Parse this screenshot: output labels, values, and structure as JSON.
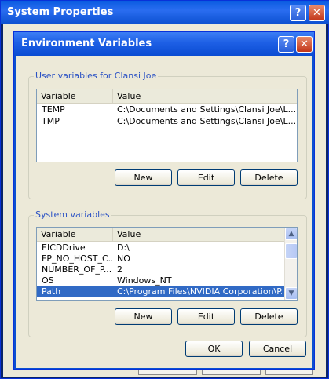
{
  "background_window": {
    "title": "System Properties",
    "help_glyph": "?",
    "close_glyph": "✕"
  },
  "dialog": {
    "title": "Environment Variables",
    "help_glyph": "?",
    "close_glyph": "✕",
    "user_group": {
      "label": "User variables for Clansi Joe",
      "columns": [
        "Variable",
        "Value"
      ],
      "rows": [
        {
          "variable": "TEMP",
          "value": "C:\\Documents and Settings\\Clansi Joe\\L..."
        },
        {
          "variable": "TMP",
          "value": "C:\\Documents and Settings\\Clansi Joe\\L..."
        }
      ],
      "buttons": {
        "new": "New",
        "edit": "Edit",
        "delete": "Delete"
      }
    },
    "system_group": {
      "label": "System variables",
      "columns": [
        "Variable",
        "Value"
      ],
      "rows": [
        {
          "variable": "EICDDrive",
          "value": "D:\\"
        },
        {
          "variable": "FP_NO_HOST_C...",
          "value": "NO"
        },
        {
          "variable": "NUMBER_OF_P...",
          "value": "2"
        },
        {
          "variable": "OS",
          "value": "Windows_NT"
        },
        {
          "variable": "Path",
          "value": "C:\\Program Files\\NVIDIA Corporation\\P..."
        }
      ],
      "selected_row": "Path",
      "buttons": {
        "new": "New",
        "edit": "Edit",
        "delete": "Delete"
      },
      "scroll_up_glyph": "▲",
      "scroll_down_glyph": "▼"
    },
    "ok_label": "OK",
    "cancel_label": "Cancel"
  },
  "colors": {
    "title_bar": "#0b4fd0",
    "selection": "#316ac5",
    "group_label": "#2b52c4"
  }
}
